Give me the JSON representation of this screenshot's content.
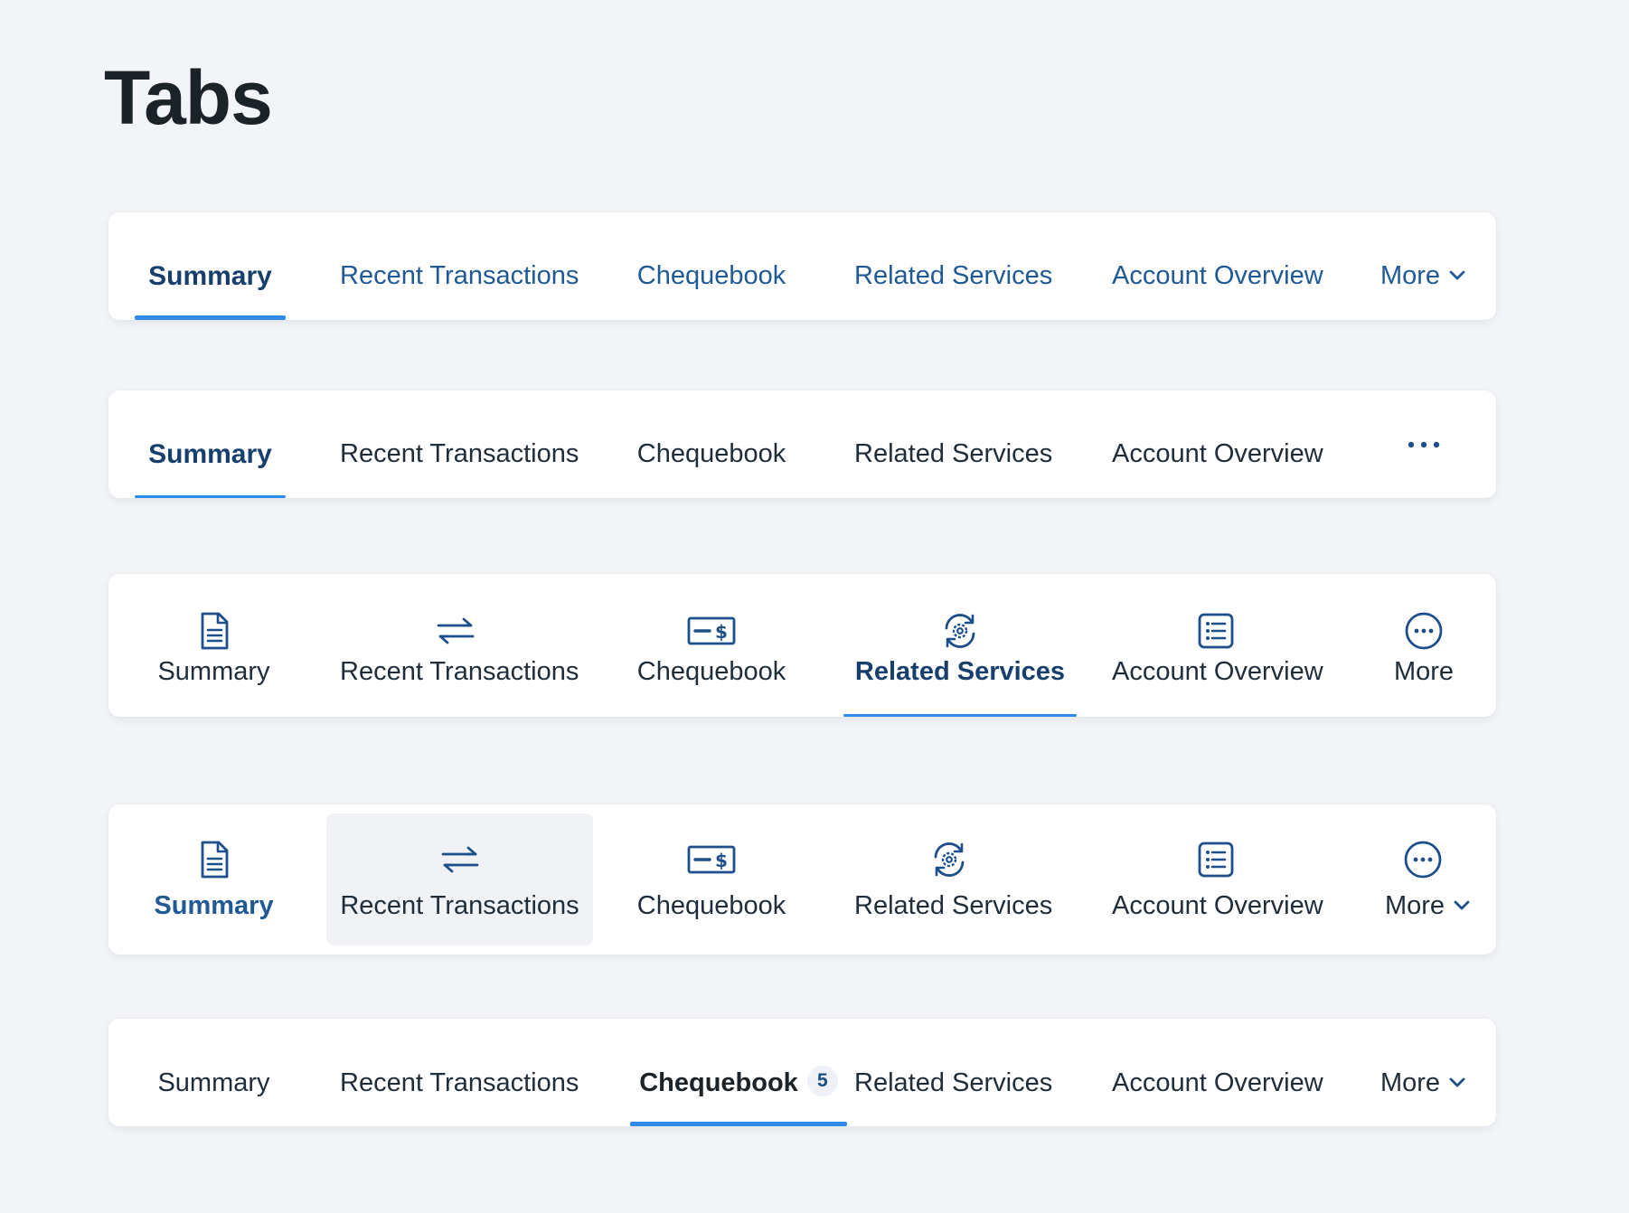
{
  "page": {
    "title": "Tabs"
  },
  "colors": {
    "accent": "#2e8ae6",
    "link": "#1f5a96",
    "active_text": "#173f6e",
    "neutral_text": "#1f2d3a",
    "icon": "#1d4f8a",
    "background": "#f2f4f8",
    "card": "#ffffff"
  },
  "tabs1": {
    "items": [
      {
        "label": "Summary"
      },
      {
        "label": "Recent Transactions"
      },
      {
        "label": "Chequebook"
      },
      {
        "label": "Related Services"
      },
      {
        "label": "Account Overview"
      },
      {
        "label": "More",
        "icon": "chevron-down-icon"
      }
    ],
    "active": "Summary"
  },
  "tabs2": {
    "items": [
      {
        "label": "Summary"
      },
      {
        "label": "Recent Transactions"
      },
      {
        "label": "Chequebook"
      },
      {
        "label": "Related Services"
      },
      {
        "label": "Account Overview"
      },
      {
        "icon": "ellipsis-icon"
      }
    ],
    "active": "Summary"
  },
  "tabs3": {
    "items": [
      {
        "label": "Summary",
        "icon": "document-icon"
      },
      {
        "label": "Recent Transactions",
        "icon": "transfer-arrows-icon"
      },
      {
        "label": "Chequebook",
        "icon": "cheque-icon"
      },
      {
        "label": "Related Services",
        "icon": "gear-refresh-icon"
      },
      {
        "label": "Account Overview",
        "icon": "list-icon"
      },
      {
        "label": "More",
        "icon": "more-circle-icon"
      }
    ],
    "active": "Related Services"
  },
  "tabs4": {
    "items": [
      {
        "label": "Summary",
        "icon": "document-icon"
      },
      {
        "label": "Recent Transactions",
        "icon": "transfer-arrows-icon"
      },
      {
        "label": "Chequebook",
        "icon": "cheque-icon"
      },
      {
        "label": "Related Services",
        "icon": "gear-refresh-icon"
      },
      {
        "label": "Account Overview",
        "icon": "list-icon"
      },
      {
        "label": "More",
        "icon": "more-circle-icon"
      }
    ],
    "active": "Summary",
    "hovered": "Recent Transactions"
  },
  "tabs5": {
    "items": [
      {
        "label": "Summary"
      },
      {
        "label": "Recent Transactions"
      },
      {
        "label": "Chequebook",
        "count": "5"
      },
      {
        "label": "Related Services"
      },
      {
        "label": "Account Overview"
      },
      {
        "label": "More",
        "icon": "chevron-down-icon"
      }
    ],
    "active": "Chequebook"
  }
}
